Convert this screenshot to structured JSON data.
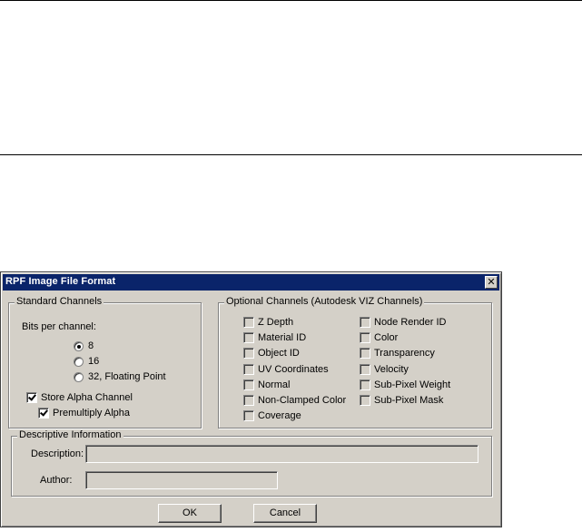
{
  "window": {
    "title": "RPF Image File Format",
    "close_glyph": "✕"
  },
  "standard_channels": {
    "legend": "Standard Channels",
    "bits_label": "Bits per channel:",
    "radio_options": [
      {
        "label": "8",
        "selected": true
      },
      {
        "label": "16",
        "selected": false
      },
      {
        "label": "32, Floating Point",
        "selected": false
      }
    ],
    "store_alpha": {
      "label": "Store Alpha Channel",
      "checked": true
    },
    "premultiply_alpha": {
      "label": "Premultiply Alpha",
      "checked": true
    }
  },
  "optional_channels": {
    "legend": "Optional Channels (Autodesk VIZ Channels)",
    "left": [
      {
        "label": "Z Depth",
        "checked": false
      },
      {
        "label": "Material ID",
        "checked": false
      },
      {
        "label": "Object ID",
        "checked": false
      },
      {
        "label": "UV Coordinates",
        "checked": false
      },
      {
        "label": "Normal",
        "checked": false
      },
      {
        "label": "Non-Clamped Color",
        "checked": false
      },
      {
        "label": "Coverage",
        "checked": false
      }
    ],
    "right": [
      {
        "label": "Node Render ID",
        "checked": false
      },
      {
        "label": "Color",
        "checked": false
      },
      {
        "label": "Transparency",
        "checked": false
      },
      {
        "label": "Velocity",
        "checked": false
      },
      {
        "label": "Sub-Pixel Weight",
        "checked": false
      },
      {
        "label": "Sub-Pixel Mask",
        "checked": false
      }
    ]
  },
  "descriptive": {
    "legend": "Descriptive Information",
    "description_label": "Description:",
    "description_value": "",
    "author_label": "Author:",
    "author_value": ""
  },
  "buttons": {
    "ok": "OK",
    "cancel": "Cancel"
  },
  "colors": {
    "titlebar": "#0a246a",
    "face": "#d4d0c8"
  }
}
